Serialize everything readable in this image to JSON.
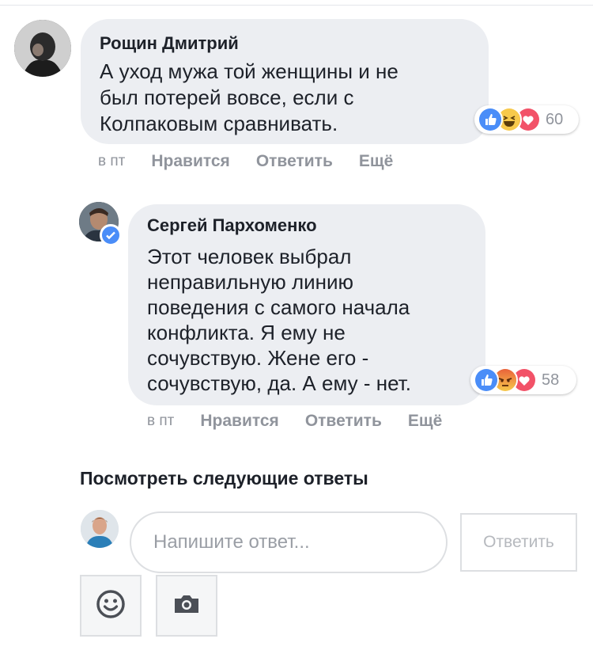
{
  "comments": [
    {
      "author": "Рощин Дмитрий",
      "text_lines": [
        "А уход мужа той женщины и не",
        "был потерей вовсе, если с",
        "Колпаковым сравнивать."
      ],
      "reactions": {
        "icons": [
          "like-icon",
          "haha-icon",
          "love-icon"
        ],
        "count": "60"
      },
      "actions": {
        "time": "в пт",
        "like": "Нравится",
        "reply": "Ответить",
        "more": "Ещё"
      }
    },
    {
      "author": "Сергей Пархоменко",
      "verified": true,
      "text_lines": [
        "Этот человек выбрал",
        "неправильную линию",
        "поведения с самого начала",
        "конфликта. Я ему не",
        "сочувствую. Жене его -",
        "сочувствую, да. А ему - нет."
      ],
      "reactions": {
        "icons": [
          "like-icon",
          "angry-icon",
          "love-icon"
        ],
        "count": "58"
      },
      "actions": {
        "time": "в пт",
        "like": "Нравится",
        "reply": "Ответить",
        "more": "Ещё"
      }
    }
  ],
  "more_replies_label": "Посмотреть следующие ответы",
  "reply_box": {
    "placeholder": "Напишите ответ...",
    "value": "",
    "submit_label": "Ответить"
  },
  "toolbar": {
    "emoji": "smiley-icon",
    "photo": "camera-icon"
  },
  "colors": {
    "like": "#4a8df8",
    "love": "#f25268",
    "haha": "#f7c94b",
    "angry": "#f07a3c",
    "bubble": "#eceef2",
    "meta": "#90949c"
  }
}
